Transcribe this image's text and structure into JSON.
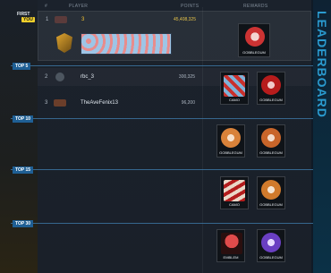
{
  "side_title": "LEADERBOARD",
  "headers": {
    "rank": "#",
    "player": "PLAYER",
    "points": "POINTS",
    "rewards": "REWARDS"
  },
  "rows": [
    {
      "rank": "1",
      "player": "3",
      "points": "45,408,325"
    },
    {
      "rank": "2",
      "player": "rbc_3",
      "points": "300,325"
    },
    {
      "rank": "3",
      "player": "TheAveFenix13",
      "points": "96,200"
    }
  ],
  "tiers": [
    {
      "label": "FIRST",
      "badge": "YOU",
      "rewards": [
        "GOBBLEGUM"
      ]
    },
    {
      "label": "TOP 5",
      "rewards": [
        "CAMO",
        "GOBBLEGUM"
      ]
    },
    {
      "label": "TOP 10",
      "rewards": [
        "GOBBLEGUM",
        "GOBBLEGUM"
      ]
    },
    {
      "label": "TOP 15",
      "rewards": [
        "CAMO",
        "GOBBLEGUM"
      ]
    },
    {
      "label": "TOP 30",
      "rewards": [
        "EMBLEM",
        "GOBBLEGUM"
      ]
    }
  ]
}
